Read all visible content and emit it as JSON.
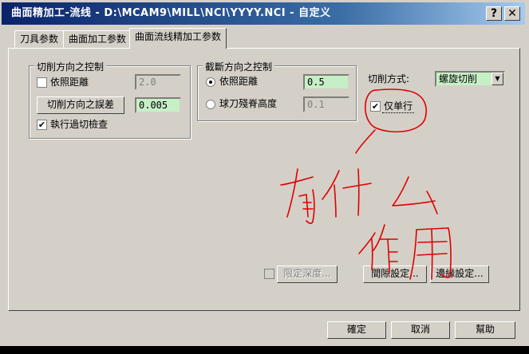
{
  "window": {
    "title": "曲面精加工-流线 - D:\\MCAM9\\MILL\\NCI\\YYYY.NCI - 自定义",
    "help_btn": "?",
    "close_btn": "✕"
  },
  "tabs": [
    {
      "label": "刀具参数"
    },
    {
      "label": "曲面加工参数"
    },
    {
      "label": "曲面流线精加工参数"
    }
  ],
  "cut_direction": {
    "title": "切削方向之控制",
    "by_distance": {
      "label": "依照距離",
      "checked": false,
      "value": "2.0"
    },
    "tolerance_button": "切削方向之誤差",
    "tolerance_value": "0.005",
    "overcut_check": {
      "label": "執行過切檢查",
      "checked": true
    }
  },
  "step_direction": {
    "title": "截斷方向之控制",
    "by_distance": {
      "label": "依照距離",
      "selected": true,
      "value": "0.5"
    },
    "scallop": {
      "label": "球刀殘脊高度",
      "selected": false,
      "value": "0.1"
    }
  },
  "cut_method": {
    "label": "切削方式:",
    "value": "螺旋切削",
    "one_way": {
      "label": "仅单行",
      "checked": true
    }
  },
  "buttons": {
    "limit_depth": "限定深度...",
    "gap_settings": "間隙設定...",
    "edge_settings": "邊緣設定...",
    "ok": "確定",
    "cancel": "取消",
    "help": "幫助"
  },
  "checkmark": "✔",
  "colors": {
    "title_start": "#0a246a",
    "field_green": "#c7efc7",
    "annotation_red": "#e00000"
  }
}
